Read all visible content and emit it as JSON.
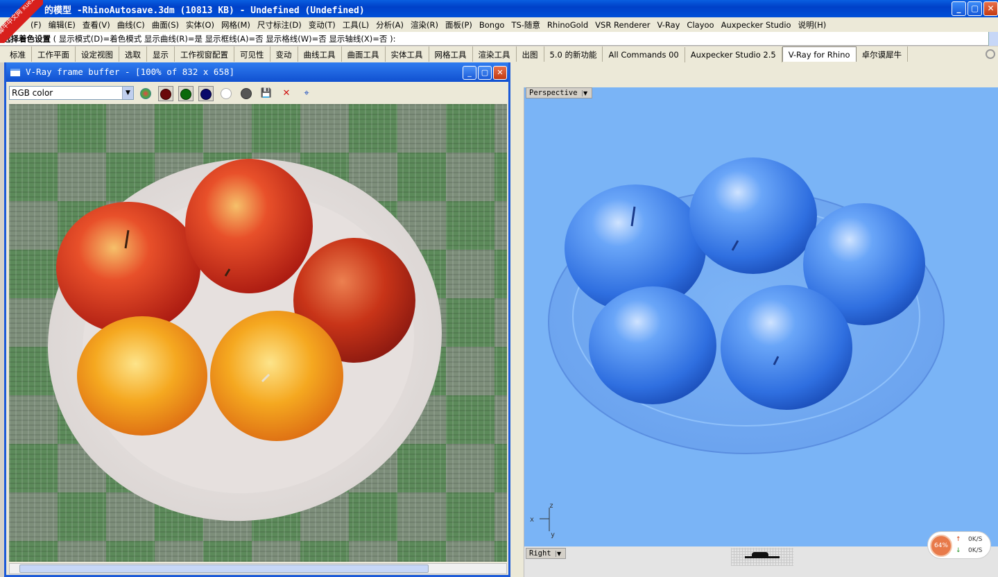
{
  "badge": {
    "text": "学犀牛中文网 xuexiniu"
  },
  "window": {
    "title": "的模型 -RhinoAutosave.3dm (10813 KB) - Undefined (Undefined)",
    "min": "_",
    "max": "▢",
    "close": "✕"
  },
  "menubar": [
    "(F)",
    "编辑(E)",
    "查看(V)",
    "曲线(C)",
    "曲面(S)",
    "实体(O)",
    "网格(M)",
    "尺寸标注(D)",
    "变动(T)",
    "工具(L)",
    "分析(A)",
    "渲染(R)",
    "面板(P)",
    "Bongo",
    "TS-随意",
    "RhinoGold",
    "VSR Renderer",
    "V-Ray",
    "Clayoo",
    "Auxpecker Studio",
    "说明(H)"
  ],
  "cmdline": {
    "label": "选择着色设置",
    "text": "( 显示模式(D)=着色模式  显示曲线(R)=是  显示框线(A)=否  显示格线(W)=否  显示轴线(X)=否 ):"
  },
  "tabs": [
    "标准",
    "工作平面",
    "设定视图",
    "选取",
    "显示",
    "工作视窗配置",
    "可见性",
    "变动",
    "曲线工具",
    "曲面工具",
    "实体工具",
    "网格工具",
    "渲染工具",
    "出图",
    "5.0 的新功能",
    "All Commands 00",
    "Auxpecker Studio 2.5",
    "V-Ray for Rhino",
    "卓尔谟犀牛"
  ],
  "active_tab": "V-Ray for Rhino",
  "vfb": {
    "title": "V-Ray frame buffer - [100% of 832 x 658]",
    "channel": "RGB color",
    "min": "_",
    "max": "▢",
    "close": "✕"
  },
  "viewports": {
    "perspective": "Perspective",
    "right": "Right",
    "axes": {
      "x": "x",
      "y": "y",
      "z": "z"
    }
  },
  "status": {
    "percent": "64%",
    "up": "0K/S",
    "down": "0K/S"
  },
  "colors": {
    "title_bar": "#0a5fe0",
    "viewport_bg": "#7ab4f6",
    "apple_blue": "#4a8cf0"
  }
}
